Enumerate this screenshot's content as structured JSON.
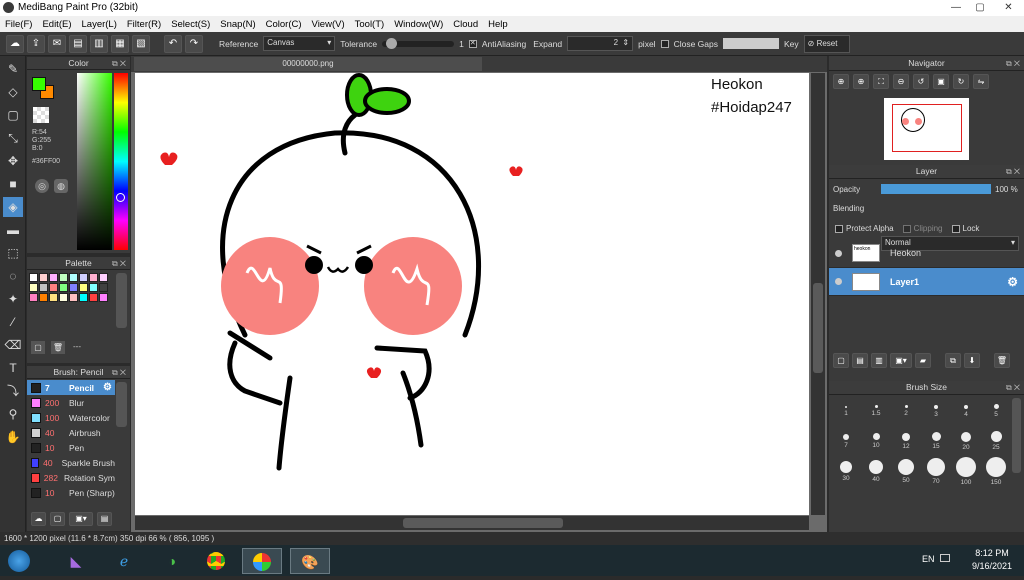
{
  "window": {
    "title": "MediBang Paint Pro (32bit)",
    "min": "—",
    "max": "▢",
    "close": "✕"
  },
  "menu": [
    "File(F)",
    "Edit(E)",
    "Layer(L)",
    "Filter(R)",
    "Select(S)",
    "Snap(N)",
    "Color(C)",
    "View(V)",
    "Tool(T)",
    "Window(W)",
    "Cloud",
    "Help"
  ],
  "toolbar": {
    "reference_label": "Reference",
    "reference_value": "Canvas",
    "tolerance_label": "Tolerance",
    "tolerance_value": "1",
    "tolerance_fraction": 0.05,
    "antialiasing_label": "AntiAliasing",
    "antialiasing_checked": true,
    "expand_label": "Expand",
    "expand_value": "2",
    "expand_unit": "pixel",
    "close_gaps_label": "Close Gaps",
    "close_gaps_checked": false,
    "key_label": "Key",
    "reset_label": "Reset"
  },
  "color_panel": {
    "title": "Color",
    "r": "R:54",
    "g": "G:255",
    "b": "B:0",
    "hex": "#36FF00",
    "fg_color": "#36ff00",
    "bg_color": "#ff8a00"
  },
  "palette_panel": {
    "title": "Palette",
    "footer": "---",
    "colors": [
      "#ffffff",
      "#ffd0d0",
      "#ffb0ff",
      "#c0ffc0",
      "#b0ffff",
      "#d0d0ff",
      "#ffb0d0",
      "#ffd0ff",
      "#ffffc0",
      "#c0c0c0",
      "#ff8080",
      "#80ff80",
      "#8080ff",
      "#ffff80",
      "#80ffff",
      "#404040",
      "#ff80c0",
      "#ff8000",
      "#ffe080",
      "#ffffe0",
      "#ffc0c0",
      "#00ffff",
      "#ff4040",
      "#ff80ff"
    ]
  },
  "brush_panel": {
    "title": "Brush: Pencil",
    "items": [
      {
        "size": "7",
        "name": "Pencil",
        "color": "#222222",
        "active": true
      },
      {
        "size": "200",
        "name": "Blur",
        "color": "#ff80ff",
        "active": false
      },
      {
        "size": "100",
        "name": "Watercolor",
        "color": "#80e0ff",
        "active": false
      },
      {
        "size": "40",
        "name": "Airbrush",
        "color": "#d0d0d0",
        "active": false
      },
      {
        "size": "10",
        "name": "Pen",
        "color": "#222222",
        "active": false
      },
      {
        "size": "40",
        "name": "Sparkle Brush",
        "color": "#4040ff",
        "active": false
      },
      {
        "size": "282",
        "name": "Rotation Sym",
        "color": "#ff4040",
        "active": false
      },
      {
        "size": "10",
        "name": "Pen (Sharp)",
        "color": "#222222",
        "active": false
      }
    ]
  },
  "document": {
    "tab": "00000000.png",
    "watermark_line1": "Heokon",
    "watermark_line2": "#Hoidap247"
  },
  "navigator": {
    "title": "Navigator"
  },
  "layer_panel": {
    "title": "Layer",
    "opacity_label": "Opacity",
    "opacity_value": "100 %",
    "opacity_fraction": 1.0,
    "blending_label": "Blending",
    "blending_value": "Normal",
    "protect_alpha": "Protect Alpha",
    "clipping": "Clipping",
    "lock": "Lock",
    "layers": [
      {
        "name": "Heokon",
        "active": false
      },
      {
        "name": "Layer1",
        "active": true
      }
    ]
  },
  "brush_size_panel": {
    "title": "Brush Size",
    "sizes": [
      "1",
      "1.5",
      "2",
      "3",
      "4",
      "5",
      "7",
      "10",
      "12",
      "15",
      "20",
      "25",
      "30",
      "40",
      "50",
      "70",
      "100",
      "150"
    ]
  },
  "status": {
    "text": "1600 * 1200 pixel   (11.6 * 8.7cm)   350 dpi   66 %   ( 856, 1095 )"
  },
  "taskbar": {
    "lang": "EN",
    "time": "8:12 PM",
    "date": "9/16/2021"
  }
}
